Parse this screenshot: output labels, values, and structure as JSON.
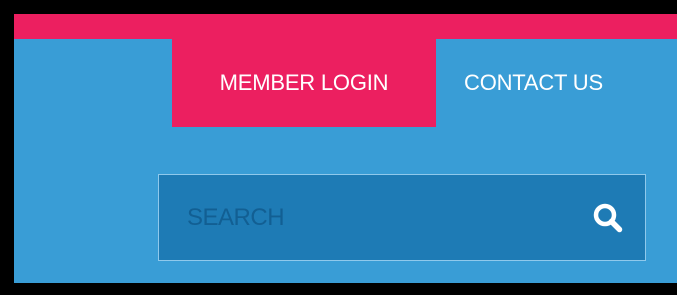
{
  "nav": {
    "member_login": "MEMBER LOGIN",
    "contact_us": "CONTACT US"
  },
  "search": {
    "placeholder": "SEARCH",
    "icon": "search-icon"
  },
  "colors": {
    "accent": "#EC1F60",
    "header_bg": "#399DD6",
    "search_bg": "#1E7BB5"
  }
}
